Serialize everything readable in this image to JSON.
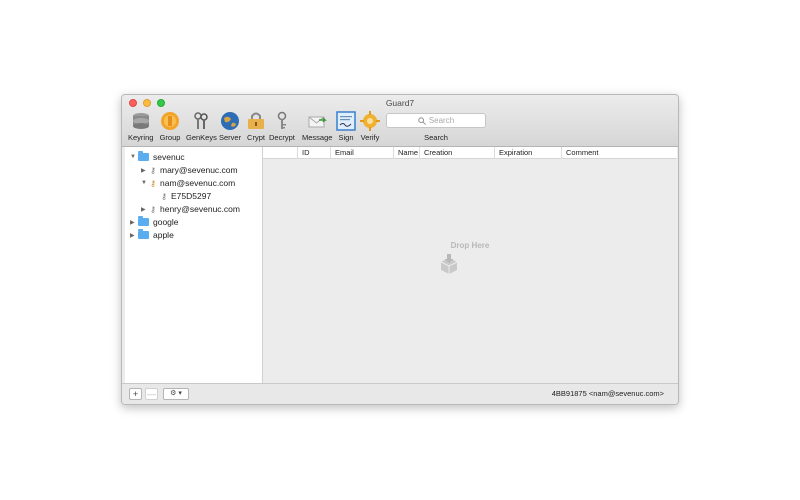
{
  "window": {
    "title": "Guard7"
  },
  "toolbar": {
    "items": [
      {
        "label": "Keyring",
        "icon": "keyring-icon"
      },
      {
        "label": "Group",
        "icon": "group-icon"
      },
      {
        "label": "GenKeys",
        "icon": "genkeys-icon"
      },
      {
        "label": "Server",
        "icon": "server-globe-icon"
      },
      {
        "label": "Crypt",
        "icon": "crypt-lock-icon"
      },
      {
        "label": "Decrypt",
        "icon": "decrypt-key-icon"
      },
      {
        "label": "Message",
        "icon": "message-envelope-icon"
      },
      {
        "label": "Sign",
        "icon": "sign-certificate-icon"
      },
      {
        "label": "Verify",
        "icon": "verify-gear-icon"
      }
    ],
    "search": {
      "placeholder": "Search",
      "label": "Search"
    }
  },
  "sidebar": {
    "tree": [
      {
        "label": "sevenuc",
        "type": "folder",
        "expanded": true
      },
      {
        "label": "mary@sevenuc.com",
        "type": "key",
        "expanded": false
      },
      {
        "label": "nam@sevenuc.com",
        "type": "key",
        "expanded": true
      },
      {
        "label": "E75D5297",
        "type": "subkey"
      },
      {
        "label": "henry@sevenuc.com",
        "type": "key",
        "expanded": false
      },
      {
        "label": "google",
        "type": "folder",
        "expanded": false
      },
      {
        "label": "apple",
        "type": "folder",
        "expanded": false
      }
    ]
  },
  "table": {
    "columns": [
      "ID",
      "Email",
      "Name",
      "Creation",
      "Expiration",
      "Comment"
    ],
    "rows": []
  },
  "dropzone": {
    "text": "Drop Here"
  },
  "bottom": {
    "add": "+",
    "remove": "—",
    "action": "⚙ ▾",
    "status": "4BB91875 <nam@sevenuc.com>"
  },
  "colors": {
    "folder": "#5aaef0",
    "close": "#fc605c",
    "minimize": "#fdbc40",
    "zoom": "#34c84a"
  }
}
